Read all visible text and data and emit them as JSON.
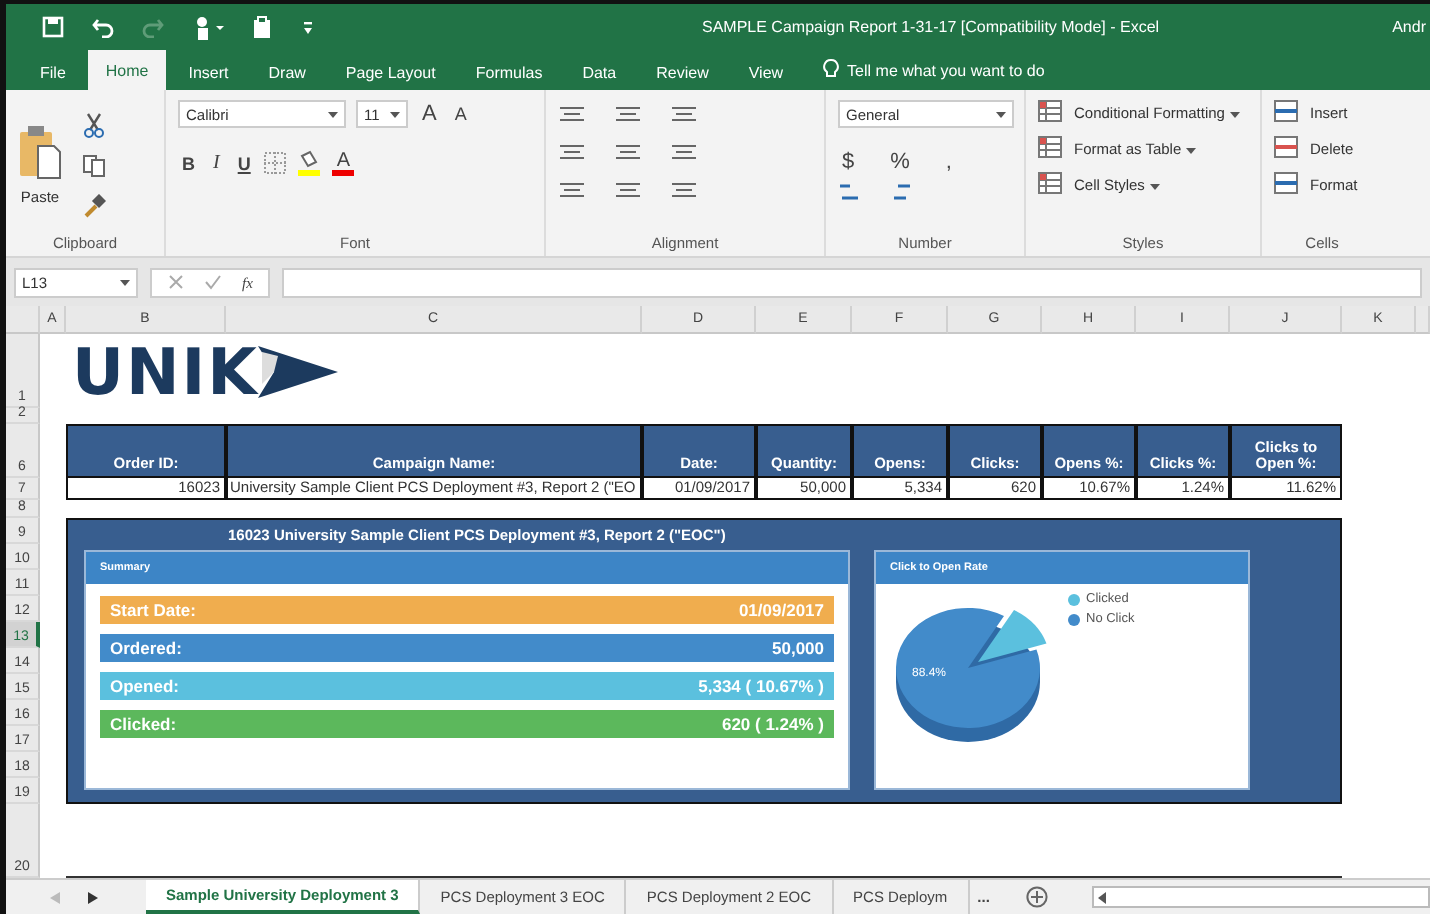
{
  "window": {
    "title": "SAMPLE Campaign Report 1-31-17  [Compatibility Mode]  -  Excel",
    "user": "Andr"
  },
  "ribbon_tabs": [
    {
      "label": "File",
      "selected": false
    },
    {
      "label": "Home",
      "selected": true
    },
    {
      "label": "Insert",
      "selected": false
    },
    {
      "label": "Draw",
      "selected": false
    },
    {
      "label": "Page Layout",
      "selected": false
    },
    {
      "label": "Formulas",
      "selected": false
    },
    {
      "label": "Data",
      "selected": false
    },
    {
      "label": "Review",
      "selected": false
    },
    {
      "label": "View",
      "selected": false
    }
  ],
  "tell_me": "Tell me what you want to do",
  "ribbon": {
    "paste_label": "Paste",
    "font_name": "Calibri",
    "font_size": "11",
    "grow_font": "A",
    "shrink_font": "A",
    "bold": "B",
    "italic": "I",
    "underline": "U",
    "font_color": "A",
    "number_format": "General",
    "currency": "$",
    "percent": "%",
    "comma": ",",
    "styles": [
      "Conditional Formatting",
      "Format as Table",
      "Cell Styles"
    ],
    "cells": [
      "Insert",
      "Delete",
      "Format"
    ],
    "groups": [
      "Clipboard",
      "Font",
      "Alignment",
      "Number",
      "Styles",
      "Cells"
    ]
  },
  "formula_bar": {
    "name_box": "L13",
    "function_label": "fx"
  },
  "columns": [
    "A",
    "B",
    "C",
    "D",
    "E",
    "F",
    "G",
    "H",
    "I",
    "J",
    "K"
  ],
  "rows": [
    {
      "label": "1",
      "selected": false
    },
    {
      "label": "2",
      "selected": false
    },
    {
      "label": "6",
      "selected": false
    },
    {
      "label": "7",
      "selected": false
    },
    {
      "label": "8",
      "selected": false
    },
    {
      "label": "9",
      "selected": false
    },
    {
      "label": "10",
      "selected": false
    },
    {
      "label": "11",
      "selected": false
    },
    {
      "label": "12",
      "selected": false
    },
    {
      "label": "13",
      "selected": true
    },
    {
      "label": "14",
      "selected": false
    },
    {
      "label": "15",
      "selected": false
    },
    {
      "label": "16",
      "selected": false
    },
    {
      "label": "17",
      "selected": false
    },
    {
      "label": "18",
      "selected": false
    },
    {
      "label": "19",
      "selected": false
    },
    {
      "label": "20",
      "selected": false
    }
  ],
  "logo": "UNIK",
  "table": {
    "headers": [
      "Order ID:",
      "Campaign Name:",
      "Date:",
      "Quantity:",
      "Opens:",
      "Clicks:",
      "Opens %:",
      "Clicks %:",
      "Clicks to Open %:"
    ],
    "row": [
      "16023",
      "University Sample Client PCS Deployment #3, Report 2 (\"EO",
      "01/09/2017",
      "50,000",
      "5,334",
      "620",
      "10.67%",
      "1.24%",
      "11.62%"
    ]
  },
  "report": {
    "title": "16023 University Sample Client PCS Deployment #3, Report 2 (\"EOC\")",
    "summary_title": "Summary",
    "metrics": [
      {
        "label": "Start Date:",
        "value": "01/09/2017",
        "color": "#f0ad4e"
      },
      {
        "label": "Ordered:",
        "value": "50,000",
        "color": "#428bca"
      },
      {
        "label": "Opened:",
        "value": "5,334 ( 10.67% )",
        "color": "#5bc0de"
      },
      {
        "label": "Clicked:",
        "value": "620 ( 1.24% )",
        "color": "#5cb85c"
      }
    ],
    "chart_title": "Click to Open Rate",
    "legend": [
      {
        "label": "Clicked",
        "color": "#5bc0de"
      },
      {
        "label": "No Click",
        "color": "#428bca"
      }
    ],
    "data_label": "88.4%"
  },
  "sheet_tabs": [
    {
      "label": "Sample University Deployment 3",
      "selected": true
    },
    {
      "label": "PCS Deployment 3 EOC",
      "selected": false
    },
    {
      "label": "PCS Deployment 2 EOC",
      "selected": false
    },
    {
      "label": "PCS Deploym",
      "selected": false
    }
  ],
  "more_tabs": "..."
}
